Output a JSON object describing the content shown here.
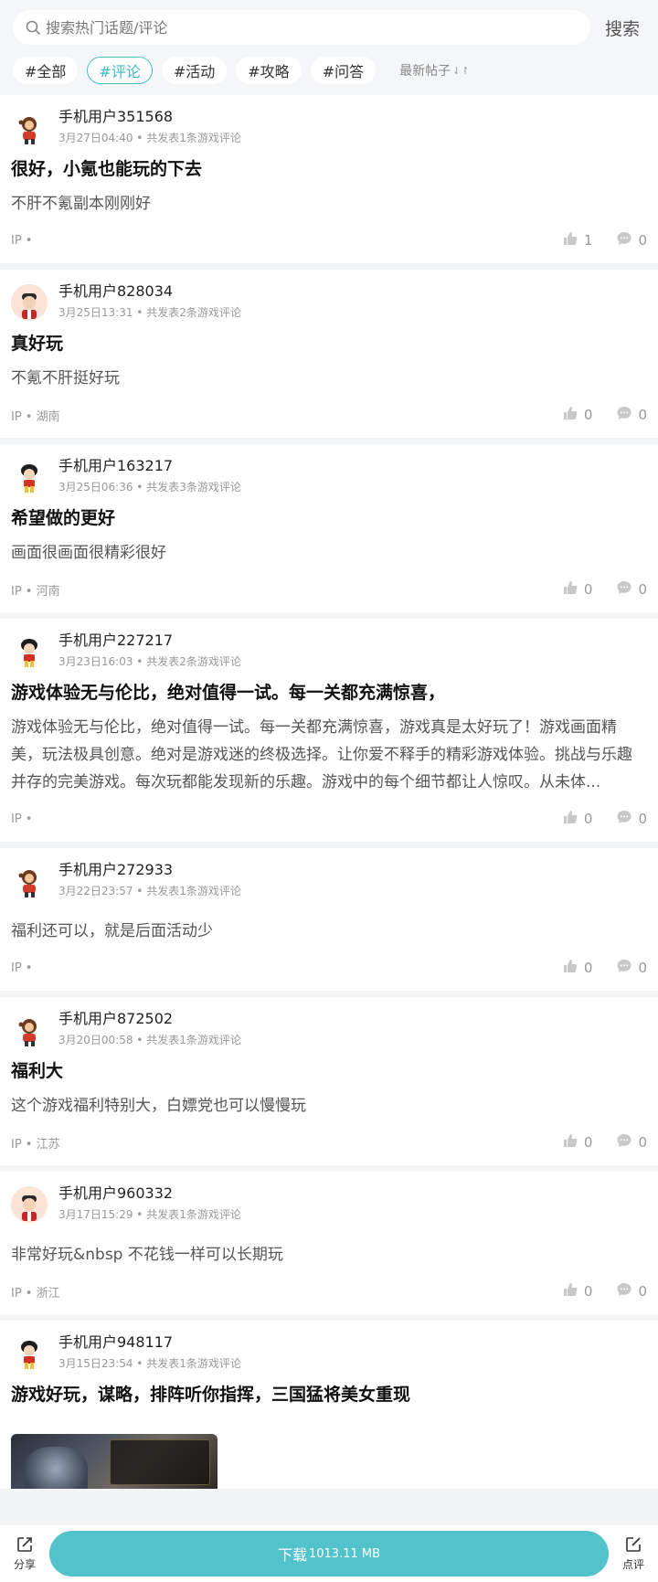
{
  "search": {
    "placeholder": "搜索热门话题/评论",
    "button_label": "搜索"
  },
  "filters": [
    {
      "label": "#全部",
      "active": false
    },
    {
      "label": "#评论",
      "active": true
    },
    {
      "label": "#活动",
      "active": false
    },
    {
      "label": "#攻略",
      "active": false
    },
    {
      "label": "#问答",
      "active": false
    }
  ],
  "sort_label": "最新帖子",
  "sort_icon": "⇃↾",
  "posts": [
    {
      "username": "手机用户351568",
      "meta": "3月27日04:40 • 共发表1条游戏评论",
      "title": "很好，小氪也能玩的下去",
      "body": "不肝不氪副本刚刚好",
      "ip": "IP •",
      "likes": "1",
      "comments": "0",
      "avatar": "monkey-avatar"
    },
    {
      "username": "手机用户828034",
      "meta": "3月25日13:31 • 共发表2条游戏评论",
      "title": "真好玩",
      "body": "不氪不肝挺好玩",
      "ip": "IP • 湖南",
      "likes": "0",
      "comments": "0",
      "avatar": "boy-avatar"
    },
    {
      "username": "手机用户163217",
      "meta": "3月25日06:36 • 共发表3条游戏评论",
      "title": "希望做的更好",
      "body": "画面很画面很精彩很好",
      "ip": "IP • 河南",
      "likes": "0",
      "comments": "0",
      "avatar": "kid-avatar"
    },
    {
      "username": "手机用户227217",
      "meta": "3月23日16:03 • 共发表2条游戏评论",
      "title": "游戏体验无与伦比，绝对值得一试。每一关都充满惊喜，",
      "body": "游戏体验无与伦比，绝对值得一试。每一关都充满惊喜，游戏真是太好玩了！游戏画面精美，玩法极具创意。绝对是游戏迷的终极选择。让你爱不释手的精彩游戏体验。挑战与乐趣并存的完美游戏。每次玩都能发现新的乐趣。游戏中的每个细节都让人惊叹。从未体...",
      "ip": "IP •",
      "likes": "0",
      "comments": "0",
      "avatar": "kid-avatar"
    },
    {
      "username": "手机用户272933",
      "meta": "3月22日23:57 • 共发表1条游戏评论",
      "title": "",
      "body": "福利还可以，就是后面活动少",
      "ip": "IP •",
      "likes": "0",
      "comments": "0",
      "avatar": "monkey-avatar"
    },
    {
      "username": "手机用户872502",
      "meta": "3月20日00:58 • 共发表1条游戏评论",
      "title": "福利大",
      "body": "这个游戏福利特别大，白嫖党也可以慢慢玩",
      "ip": "IP • 江苏",
      "likes": "0",
      "comments": "0",
      "avatar": "monkey-avatar"
    },
    {
      "username": "手机用户960332",
      "meta": "3月17日15:29 • 共发表1条游戏评论",
      "title": "",
      "body": "非常好玩&nbsp 不花钱一样可以长期玩",
      "ip": "IP • 浙江",
      "likes": "0",
      "comments": "0",
      "avatar": "boy-avatar"
    },
    {
      "username": "手机用户948117",
      "meta": "3月15日23:54 • 共发表1条游戏评论",
      "title": "游戏好玩，谋略，排阵听你指挥，三国猛将美女重现",
      "body": "",
      "ip": "",
      "likes": "",
      "comments": "",
      "avatar": "kid-avatar",
      "has_image": true
    }
  ],
  "bottom": {
    "share_label": "分享",
    "download_label": "下载",
    "download_size": "1013.11 MB",
    "review_label": "点评"
  },
  "colors": {
    "accent": "#52c3cb",
    "active_filter": "#3fb8c4"
  }
}
